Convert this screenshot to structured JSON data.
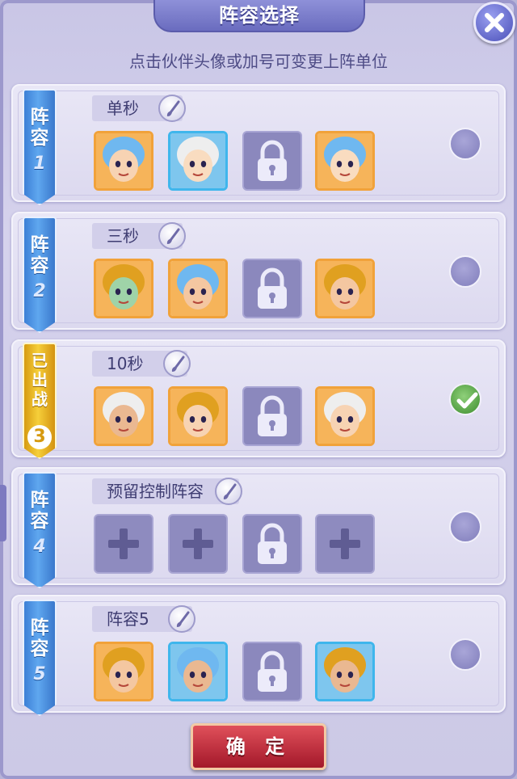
{
  "title": "阵容选择",
  "hint": "点击伙伴头像或加号可变更上阵单位",
  "confirm_label": "确 定",
  "formations": [
    {
      "ribbon_text": "阵容",
      "number": "1",
      "name": "单秒",
      "selected": false,
      "slots": [
        {
          "type": "hero",
          "portrait": "blue-haired-girl-with-headdress-portrait",
          "frame": "orange"
        },
        {
          "type": "hero",
          "portrait": "blue-haired-warrior-portrait",
          "frame": "blue"
        },
        {
          "type": "locked",
          "icon": "lock-icon"
        },
        {
          "type": "hero",
          "portrait": "purple-haired-woman-portrait",
          "frame": "orange"
        }
      ]
    },
    {
      "ribbon_text": "阵容",
      "number": "2",
      "name": "三秒",
      "selected": false,
      "slots": [
        {
          "type": "hero",
          "portrait": "bearded-man-portrait",
          "frame": "orange"
        },
        {
          "type": "hero",
          "portrait": "white-bearded-elder-portrait",
          "frame": "orange"
        },
        {
          "type": "locked",
          "icon": "lock-icon"
        },
        {
          "type": "hero",
          "portrait": "purple-haired-woman-portrait",
          "frame": "orange"
        }
      ]
    },
    {
      "ribbon_text": "已出战",
      "number": "3",
      "name": "10秒",
      "selected": true,
      "slots": [
        {
          "type": "hero",
          "portrait": "crowned-girl-portrait",
          "frame": "orange"
        },
        {
          "type": "hero",
          "portrait": "armored-warrior-portrait",
          "frame": "orange"
        },
        {
          "type": "locked",
          "icon": "lock-icon"
        },
        {
          "type": "hero",
          "portrait": "green-dragon-king-portrait",
          "frame": "orange"
        }
      ]
    },
    {
      "ribbon_text": "阵容",
      "number": "4",
      "name": "预留控制阵容",
      "selected": false,
      "slots": [
        {
          "type": "empty",
          "icon": "plus-icon"
        },
        {
          "type": "empty",
          "icon": "plus-icon"
        },
        {
          "type": "locked",
          "icon": "lock-icon"
        },
        {
          "type": "empty",
          "icon": "plus-icon"
        }
      ]
    },
    {
      "ribbon_text": "阵容",
      "number": "5",
      "name": "阵容5",
      "selected": false,
      "slots": [
        {
          "type": "hero",
          "portrait": "blue-haired-girl-with-headdress-portrait",
          "frame": "orange"
        },
        {
          "type": "hero",
          "portrait": "blue-haired-warrior-portrait",
          "frame": "blue"
        },
        {
          "type": "locked",
          "icon": "lock-icon"
        },
        {
          "type": "hero",
          "portrait": "angry-strongman-portrait",
          "frame": "blue"
        }
      ]
    }
  ],
  "colors": {
    "panel": "#cdcae8",
    "ribbon_blue": "#4a8fe0",
    "ribbon_gold": "#f0c030",
    "hero_frame_orange": "#f1a23a",
    "hero_frame_blue": "#3fb6ec",
    "confirm_red": "#c02a38",
    "check_green": "#5aae3c"
  }
}
